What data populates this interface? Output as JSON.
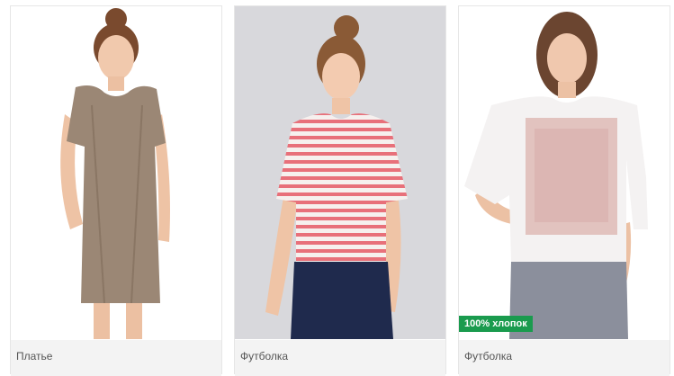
{
  "products": [
    {
      "name": "Платье",
      "badge": ""
    },
    {
      "name": "Футболка",
      "badge": ""
    },
    {
      "name": "Футболка",
      "badge": "100% хлопок"
    }
  ],
  "colors": {
    "badge_bg": "#1a9b4e",
    "caption_bg": "#f3f3f3",
    "card_border": "#e6e6e6"
  },
  "icons": {
    "product_1": "dress-photo",
    "product_2": "striped-tshirt-photo",
    "product_3": "print-tshirt-photo"
  }
}
